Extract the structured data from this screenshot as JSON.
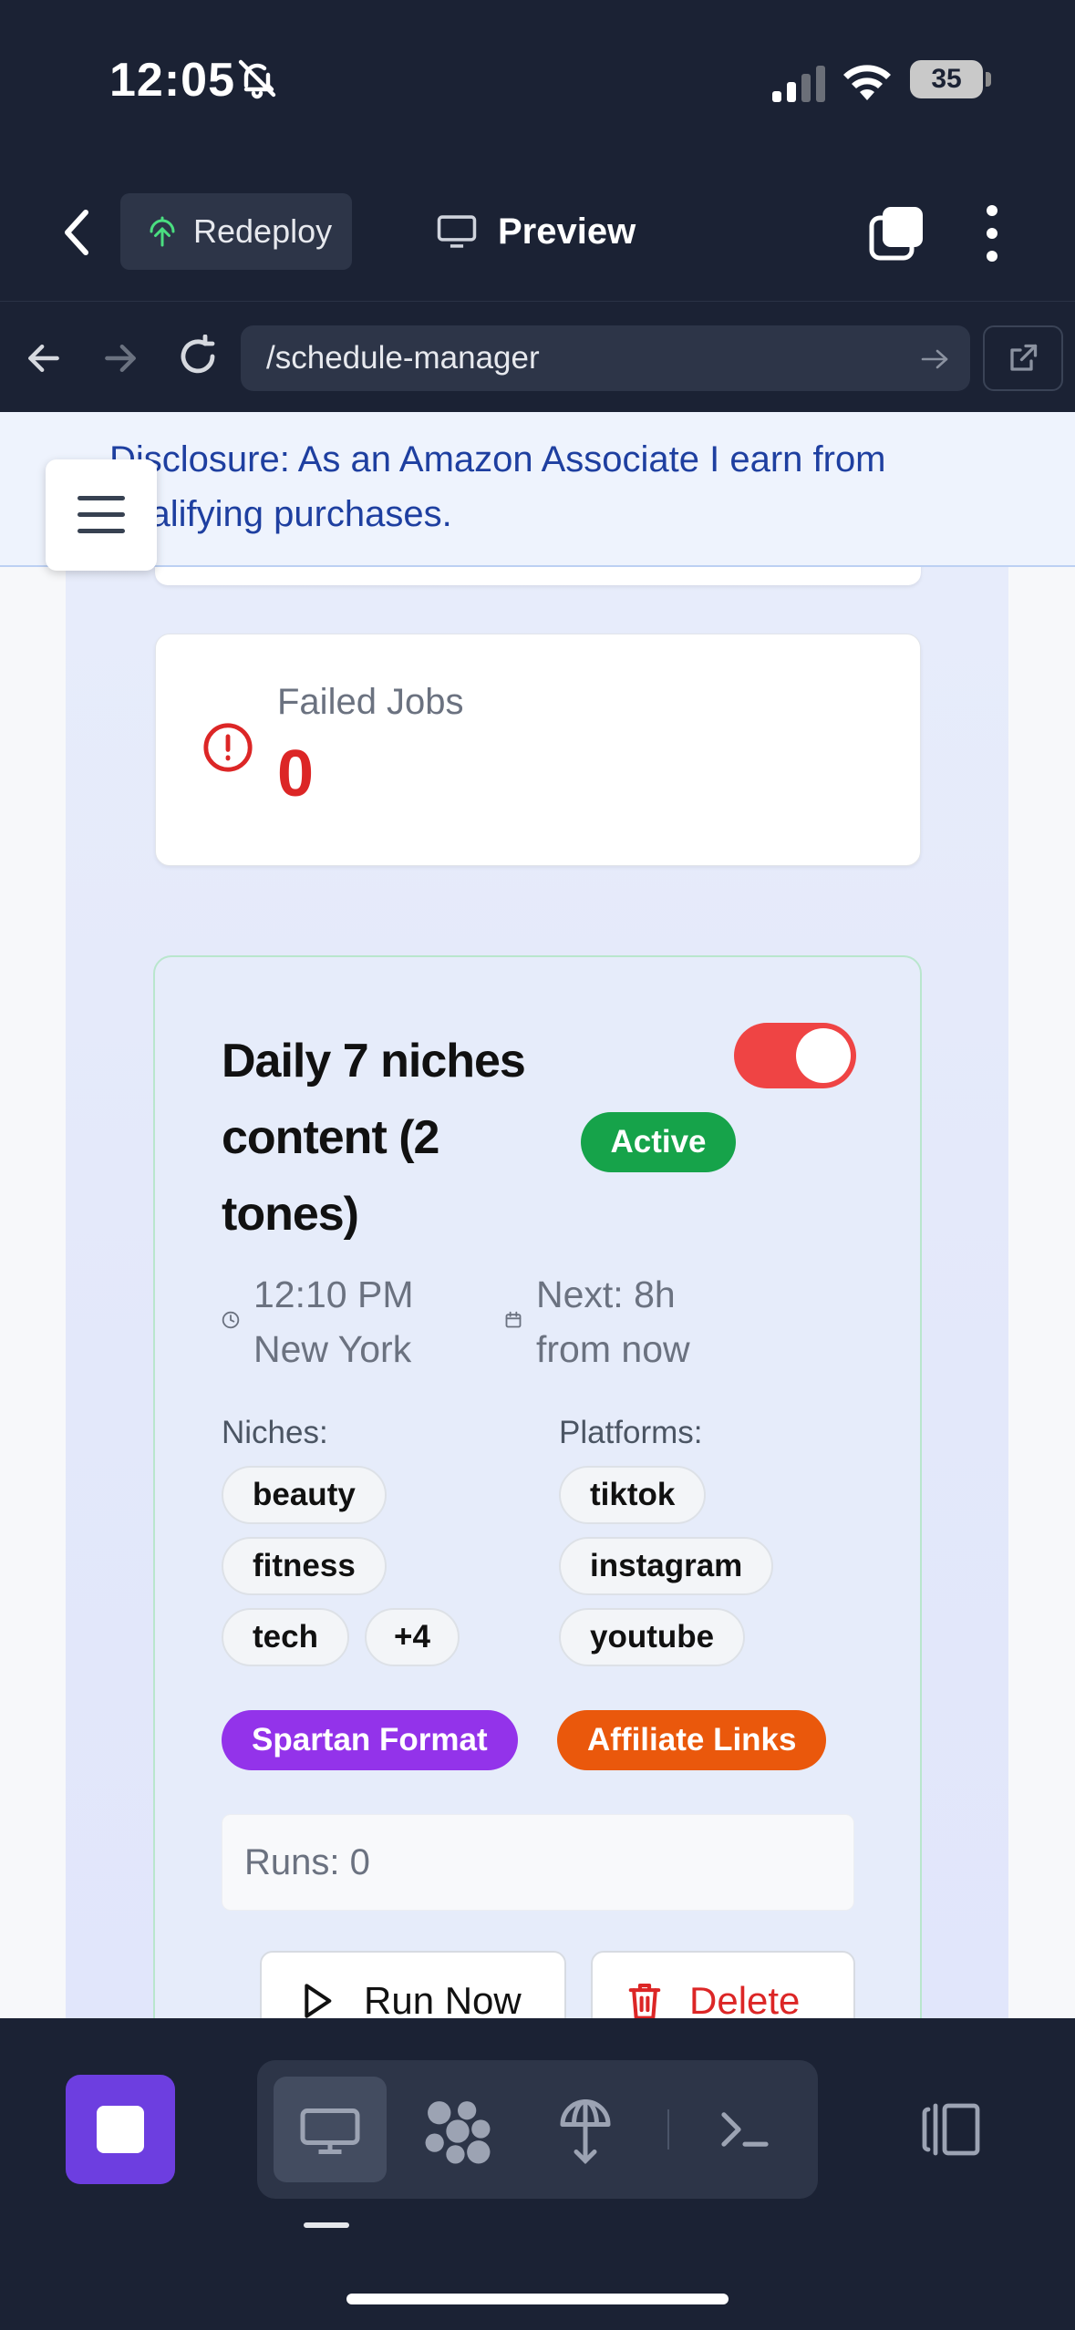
{
  "status_bar": {
    "time": "12:05",
    "battery": "35"
  },
  "app_header": {
    "redeploy_label": "Redeploy",
    "preview_label": "Preview"
  },
  "browser": {
    "url": "/schedule-manager"
  },
  "disclosure": {
    "text": "Disclosure: As an Amazon Associate I earn from qualifying purchases."
  },
  "failed_jobs": {
    "label": "Failed Jobs",
    "value": "0"
  },
  "schedule": {
    "title": "Daily 7 niches content (2 tones)",
    "enabled": true,
    "status": "Active",
    "time": "12:10 PM New York",
    "next": "Next: 8h from now",
    "niches_label": "Niches:",
    "niches": [
      "beauty",
      "fitness",
      "tech",
      "+4"
    ],
    "platforms_label": "Platforms:",
    "platforms": [
      "tiktok",
      "instagram",
      "youtube"
    ],
    "features": [
      "Spartan Format",
      "Affiliate Links"
    ],
    "runs": "Runs: 0",
    "run_now_label": "Run Now",
    "delete_label": "Delete"
  },
  "colors": {
    "toggle_on": "#ef4444",
    "active_badge": "#16a34a",
    "spartan": "#9333ea",
    "affiliate": "#ea580c",
    "danger": "#dc2626",
    "stop_button": "#6d3ee0"
  }
}
